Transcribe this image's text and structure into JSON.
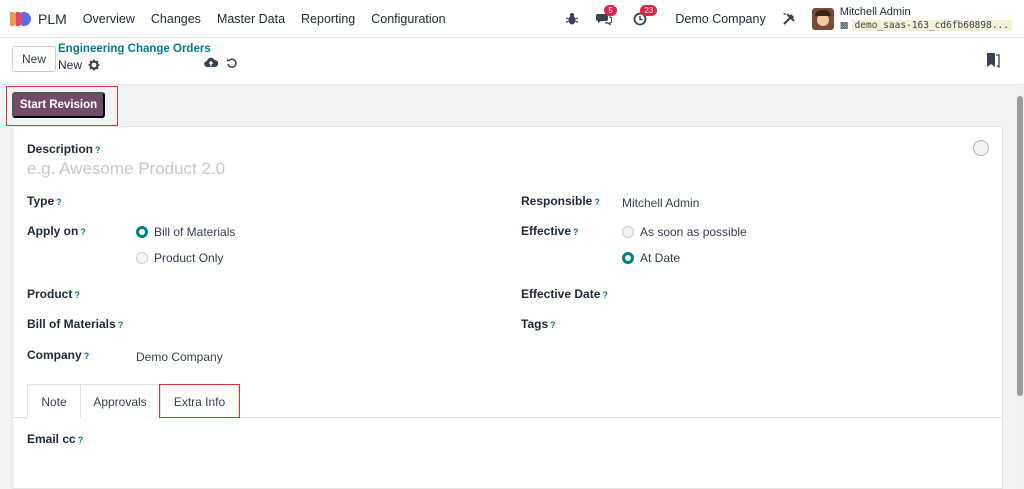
{
  "navbar": {
    "app_name": "PLM",
    "menu": [
      "Overview",
      "Changes",
      "Master Data",
      "Reporting",
      "Configuration"
    ],
    "messages_count": "5",
    "activities_count": "23",
    "company": "Demo Company",
    "user_name": "Mitchell Admin",
    "database": "demo_saas-163_cd6fb60898..."
  },
  "control_panel": {
    "new_button": "New",
    "breadcrumb": "Engineering Change Orders",
    "record_name": "New"
  },
  "statusbar": {
    "start_revision_button": "Start Revision"
  },
  "form": {
    "description_label": "Description",
    "description_placeholder": "e.g. Awesome Product 2.0",
    "type_label": "Type",
    "apply_on_label": "Apply on",
    "apply_on_options": [
      "Bill of Materials",
      "Product Only"
    ],
    "apply_on_selected": "Bill of Materials",
    "product_label": "Product",
    "bom_label": "Bill of Materials",
    "company_label": "Company",
    "company_value": "Demo Company",
    "responsible_label": "Responsible",
    "responsible_value": "Mitchell Admin",
    "effective_label": "Effective",
    "effective_options": [
      "As soon as possible",
      "At Date"
    ],
    "effective_selected": "At Date",
    "effective_date_label": "Effective Date",
    "tags_label": "Tags",
    "help_mark": "?"
  },
  "tabs": {
    "items": [
      "Note",
      "Approvals",
      "Extra Info"
    ],
    "active": "Extra Info"
  },
  "extra_info": {
    "email_cc_label": "Email cc"
  },
  "colors": {
    "primary": "#714b67",
    "accent": "#017e84",
    "highlight": "#d9363e",
    "badge": "#e2234a"
  }
}
